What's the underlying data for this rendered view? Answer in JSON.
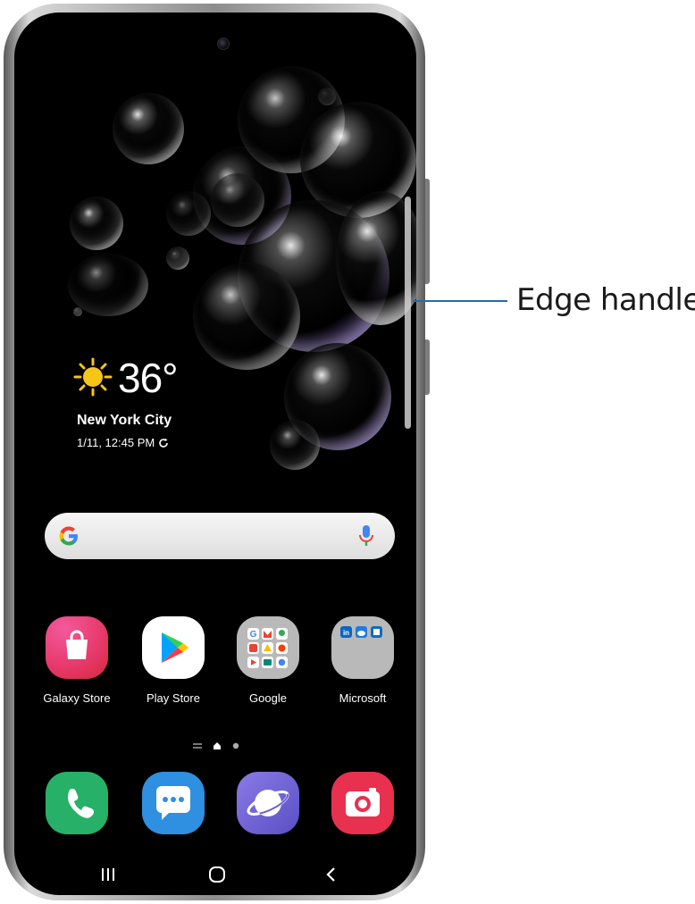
{
  "weather": {
    "temperature": "36°",
    "city": "New York City",
    "datetime": "1/11, 12:45 PM"
  },
  "search": {
    "logo": "G"
  },
  "apps": [
    {
      "label": "Galaxy Store",
      "icon": "galaxy-store-icon"
    },
    {
      "label": "Play Store",
      "icon": "play-store-icon"
    },
    {
      "label": "Google",
      "icon": "google-folder-icon"
    },
    {
      "label": "Microsoft",
      "icon": "microsoft-folder-icon"
    }
  ],
  "dock": [
    {
      "icon": "phone-icon",
      "color": "#27b067"
    },
    {
      "icon": "messages-icon",
      "color": "#2f8fe0"
    },
    {
      "icon": "internet-icon",
      "color": "#6a5fd0"
    },
    {
      "icon": "camera-icon",
      "color": "#e8314f"
    }
  ],
  "callout": {
    "label": "Edge handle",
    "color": "#1f6ea6"
  },
  "colors": {
    "galaxy_store": "#e83a6d",
    "play_store_bg": "#ffffff",
    "folder_bg": "#b9b9b9"
  }
}
